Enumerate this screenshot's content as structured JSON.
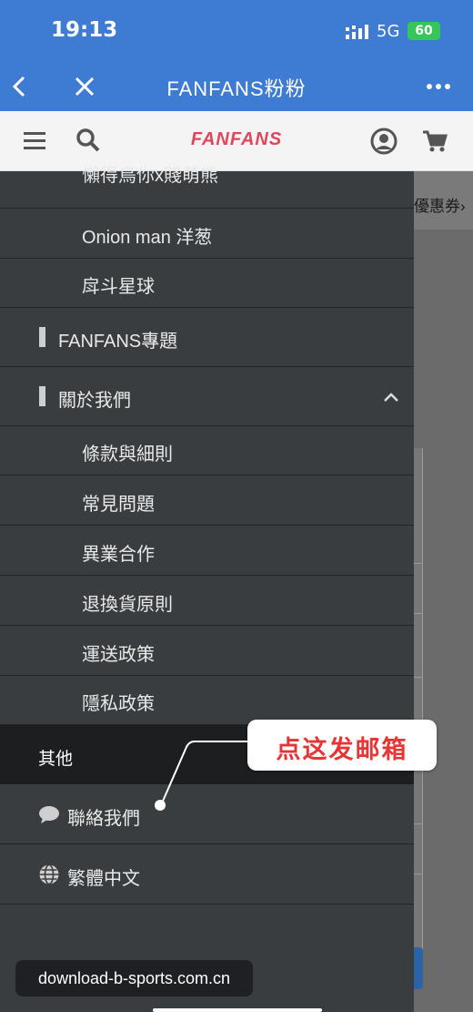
{
  "status_bar": {
    "time": "19:13",
    "network": "5G",
    "battery": "60"
  },
  "title_bar": {
    "title": "FANFANS粉粉"
  },
  "site_header": {
    "logo": "FANFANS"
  },
  "background_page": {
    "coupon_text": "優惠券›"
  },
  "sidebar": {
    "sub_items_top": [
      {
        "label": "懶得鳥你x賤萌熊"
      },
      {
        "label": "Onion man 洋葱"
      },
      {
        "label": "戽斗星球"
      }
    ],
    "section_special": {
      "label": "FANFANS專題"
    },
    "section_about": {
      "label": "關於我們",
      "items": [
        {
          "label": "條款與細則"
        },
        {
          "label": "常見問題"
        },
        {
          "label": "異業合作"
        },
        {
          "label": "退換貨原則"
        },
        {
          "label": "運送政策"
        },
        {
          "label": "隱私政策"
        }
      ]
    },
    "other_header": "其他",
    "contact": {
      "label": "聯絡我們",
      "icon": "chat-bubble-icon"
    },
    "language": {
      "label": "繁體中文",
      "icon": "globe-icon"
    }
  },
  "annotation": {
    "text": "点这发邮箱",
    "color": "#e83434"
  },
  "watermark": {
    "text": "download-b-sports.com.cn"
  },
  "colors": {
    "brand_blue": "#3e7bd2",
    "logo_pink": "#e0475d",
    "drawer_bg": "#3a3d3f"
  }
}
